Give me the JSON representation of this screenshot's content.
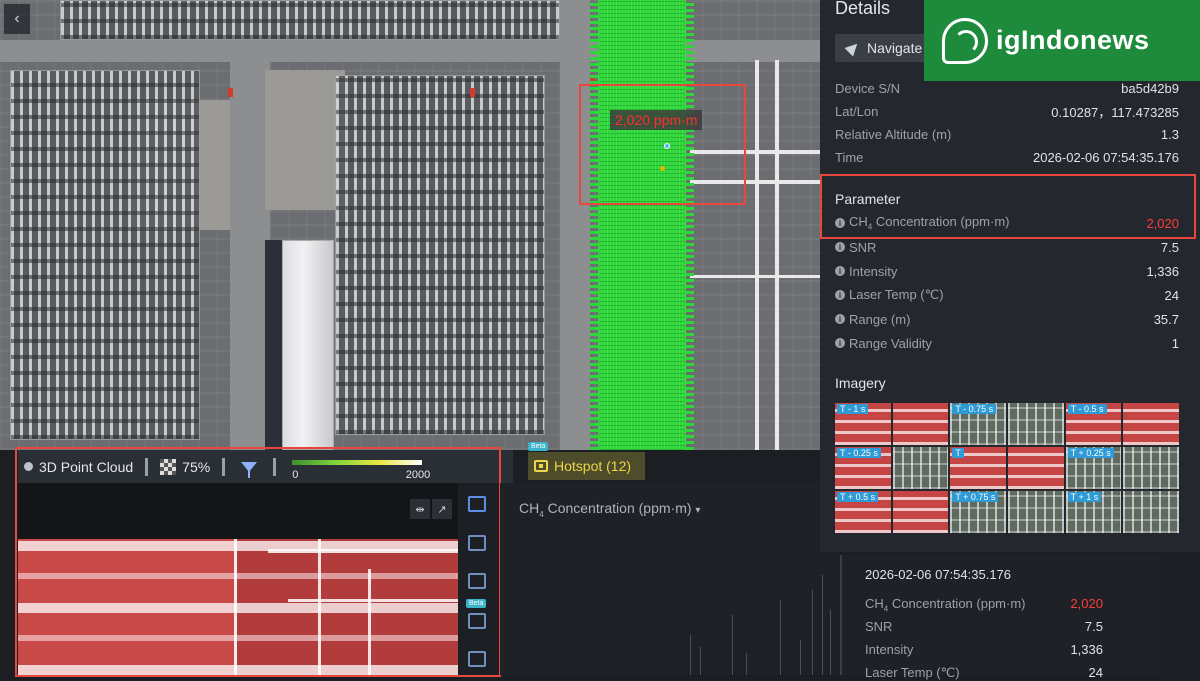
{
  "map": {
    "back_icon": "chevron-left-icon",
    "ppm_label": "2,020 ppm·m"
  },
  "toolbar": {
    "point_cloud_label": "3D Point Cloud",
    "opacity_value": "75%",
    "scale_min": "0",
    "scale_max": "2000",
    "hotspot_beta": "Beta",
    "hotspot_label": "Hotspot (12)"
  },
  "side_panel": {
    "beta": "Beta",
    "icons": [
      "image-icon",
      "panel-icon",
      "table-icon",
      "checklist-icon",
      "layers-icon"
    ]
  },
  "chart": {
    "title_prefix": "CH",
    "title_sub": "4",
    "title_suffix": " Concentration (ppm·m)",
    "dropdown_icon": "caret-down-icon"
  },
  "chart_data": {
    "type": "bar",
    "categories": [],
    "values": [],
    "title": "CH4 Concentration (ppm·m)"
  },
  "details": {
    "title": "Details",
    "navigate_label": "Navigate",
    "device_rows": [
      {
        "label": "Device S/N",
        "value": "ba5d42b9"
      },
      {
        "label": "Lat/Lon",
        "value": "0.10287，117.473285"
      },
      {
        "label": "Relative Altitude (m)",
        "value": "1.3"
      },
      {
        "label": "Time",
        "value": "2026-02-06 07:54:35.176"
      }
    ],
    "parameter_heading": "Parameter",
    "ch4": {
      "label_prefix": "CH",
      "label_sub": "4",
      "label_suffix": " Concentration (ppm·m)",
      "value": "2,020"
    },
    "param_rows": [
      {
        "label": "SNR",
        "value": "7.5"
      },
      {
        "label": "Intensity",
        "value": "1,336"
      },
      {
        "label": "Laser Temp (℃)",
        "value": "24"
      },
      {
        "label": "Range (m)",
        "value": "35.7"
      },
      {
        "label": "Range Validity",
        "value": "1"
      }
    ],
    "imagery_heading": "Imagery",
    "imagery_labels": [
      "T - 1 s",
      "T - 0.75 s",
      "T - 0.5 s",
      "T - 0.25 s",
      "T",
      "T + 0.25 s",
      "T + 0.5 s",
      "T + 0.75 s",
      "T + 1 s"
    ]
  },
  "readout": {
    "time": "2026-02-06 07:54:35.176",
    "ch4_prefix": "CH",
    "ch4_sub": "4",
    "ch4_suffix": " Concentration (ppm·m)",
    "ch4_value": "2,020",
    "snr_label": "SNR",
    "snr_value": "7.5",
    "intensity_label": "Intensity",
    "intensity_value": "1,336",
    "laser_label": "Laser Temp (℃)",
    "laser_value": "24"
  },
  "logo": {
    "text": "igIndonews"
  },
  "colors": {
    "highlight_red": "#e8473e",
    "plume_green": "#2fd63b",
    "value_red": "#ff3b3b",
    "hotspot_yellow": "#ecd54a",
    "logo_green": "#1e8a3c"
  }
}
